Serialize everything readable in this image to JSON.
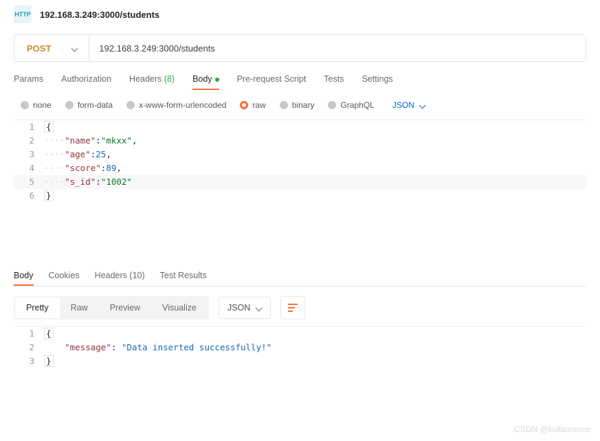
{
  "header": {
    "icon_label": "HTTP",
    "title": "192.168.3.249:3000/students"
  },
  "request": {
    "method": "POST",
    "url": "192.168.3.249:3000/students"
  },
  "tabs": {
    "params": "Params",
    "auth": "Authorization",
    "headers": "Headers",
    "headers_count": "(8)",
    "body": "Body",
    "prereq": "Pre-request Script",
    "tests": "Tests",
    "settings": "Settings"
  },
  "body_types": {
    "none": "none",
    "formdata": "form-data",
    "urlenc": "x-www-form-urlencoded",
    "raw": "raw",
    "binary": "binary",
    "graphql": "GraphQL",
    "format": "JSON"
  },
  "req_body": {
    "l1": "{",
    "l2_key": "\"name\"",
    "l2_val": "\"mkxx\"",
    "l3_key": "\"age\"",
    "l3_val": "25",
    "l4_key": "\"score\"",
    "l4_val": "89",
    "l5_key": "\"s_id\"",
    "l5_val": "\"1002\"",
    "l6": "}"
  },
  "resp_tabs": {
    "body": "Body",
    "cookies": "Cookies",
    "headers": "Headers",
    "headers_count": "(10)",
    "tests": "Test Results"
  },
  "resp_ctrl": {
    "pretty": "Pretty",
    "raw": "Raw",
    "preview": "Preview",
    "visualize": "Visualize",
    "fmt": "JSON"
  },
  "resp_body": {
    "l1": "{",
    "l2_key": "\"message\"",
    "l2_val": "\"Data inserted successfully!\"",
    "l3": "}"
  },
  "watermark": "CSDN @kuilaurence"
}
